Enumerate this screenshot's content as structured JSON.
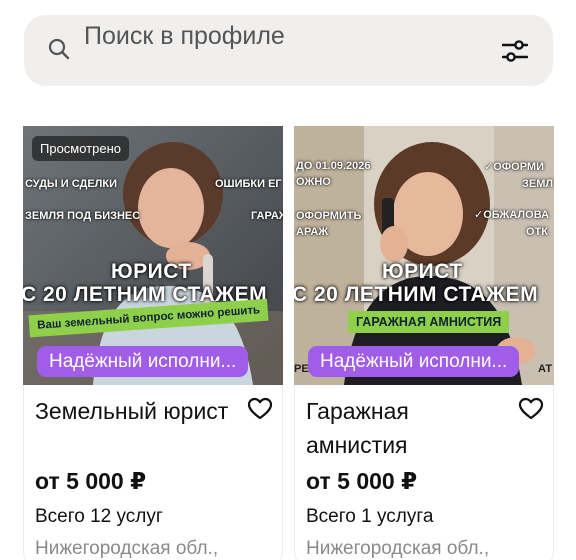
{
  "search": {
    "placeholder": "Поиск в профиле"
  },
  "colors": {
    "accent_purple": "#a05de8",
    "search_bg": "#f0efee",
    "green_stripe": "#8fd04a"
  },
  "cards": [
    {
      "viewed_badge": "Просмотрено",
      "overlay": {
        "line1_left": "СУДЫ И СДЕЛКИ",
        "line1_right": "ОШИБКИ ЕГ",
        "line2_left": "ЗЕМЛЯ ПОД БИЗНЕС",
        "line2_right": "ГАРАЖ",
        "headline1": "ЮРИСТ",
        "headline2": "С 20 ЛЕТНИМ СТАЖЕМ",
        "stripe": "Ваш земельный вопрос можно решить"
      },
      "tag": "Надёжный исполни...",
      "title": "Земельный юрист",
      "price": "от 5 000 ₽",
      "services": "Всего 12 услуг",
      "region": "Нижегородская обл.,"
    },
    {
      "overlay": {
        "line1_left": "ДО 01.09.2026",
        "line1_left_b": "ОЖНО",
        "line1_right": "✓ОФОРМИ",
        "line1_right_b": "ЗЕМЛ",
        "line2_left": "ОФОРМИТЬ",
        "line2_left_b": "АРАЖ",
        "line2_right": "✓ОБЖАЛОВА",
        "line2_right_b": "ОТК",
        "headline1": "ЮРИСТ",
        "headline2": "С 20 ЛЕТНИМ СТАЖЕМ",
        "stripe": "ГАРАЖНАЯ АМНИСТИЯ",
        "edge_left": "РЕ",
        "edge_right": "АТ"
      },
      "tag": "Надёжный исполни...",
      "title": "Гаражная амнистия",
      "price": "от 5 000 ₽",
      "services": "Всего 1 услуга",
      "region": "Нижегородская обл.,"
    }
  ]
}
